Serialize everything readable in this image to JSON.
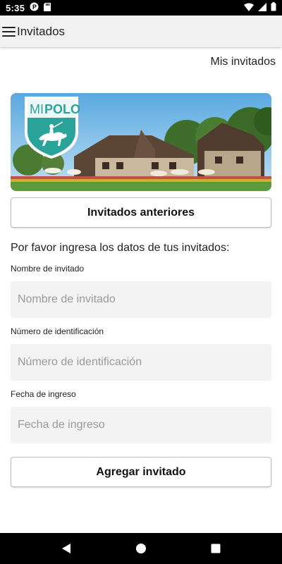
{
  "status_bar": {
    "time": "5:35",
    "icons_left": [
      "p-notification-icon",
      "sd-card-icon"
    ],
    "icons_right": [
      "wifi-icon",
      "signal-icon",
      "battery-icon"
    ]
  },
  "app_bar": {
    "title": "Invitados",
    "menu_icon": "hamburger-menu-icon"
  },
  "header_link": "Mis invitados",
  "hero": {
    "logo_text_mi": "MI",
    "logo_text_polo": "POLO",
    "logo_color": "#2aa39a"
  },
  "buttons": {
    "previous_guests": "Invitados anteriores",
    "add_guest": "Agregar invitado"
  },
  "intro_text": "Por favor ingresa los datos de tus invitados:",
  "fields": {
    "name": {
      "label": "Nombre de invitado",
      "placeholder": "Nombre de invitado",
      "value": ""
    },
    "id": {
      "label": "Número de identificación",
      "placeholder": "Número de identificación",
      "value": ""
    },
    "date": {
      "label": "Fecha de ingreso",
      "placeholder": "Fecha de ingreso",
      "value": ""
    }
  },
  "nav_bar": {
    "icons": [
      "back-icon",
      "home-icon",
      "recents-icon"
    ]
  },
  "colors": {
    "status_bar": "#000000",
    "app_bar": "#f1f1f1",
    "field_bg": "#f3f3f3",
    "accent": "#2aa39a"
  }
}
